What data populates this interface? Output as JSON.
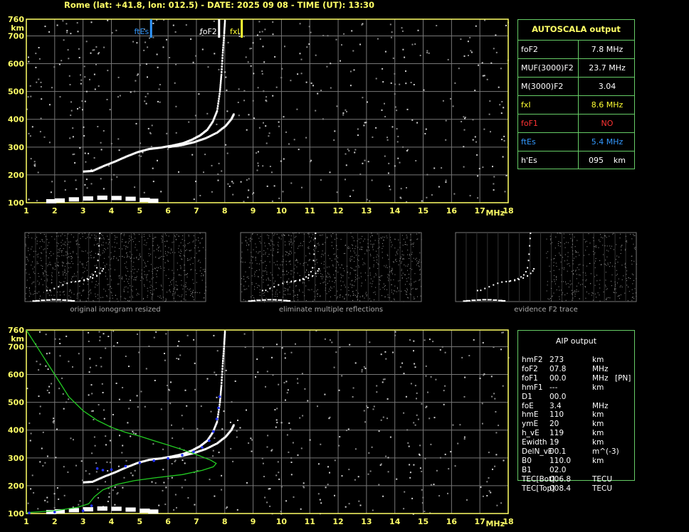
{
  "header": {
    "title": "Rome (lat: +41.8, lon: 012.5) - DATE: 2025 09 08 - TIME (UT): 13:30"
  },
  "colors": {
    "axis": "#ffff66",
    "grid": "#777777",
    "panel_border": "#66cc66",
    "fte": "#3399ff",
    "fxi": "#ffff33",
    "fof1": "#ff3333",
    "trace": "#ffffff",
    "profile": "#22cc22",
    "fit": "#2233ff"
  },
  "chart_data": [
    {
      "type": "scatter",
      "name": "ionogram",
      "xlabel": "MHz",
      "ylabel": "km",
      "xlim": [
        1,
        18
      ],
      "ylim": [
        100,
        760
      ],
      "xticks": [
        "1",
        "2",
        "3",
        "4",
        "5",
        "6",
        "7",
        "8",
        "9",
        "10",
        "11",
        "12",
        "13",
        "14",
        "15",
        "16",
        "17",
        "18"
      ],
      "yticks": [
        "100",
        "200",
        "300",
        "400",
        "500",
        "600",
        "700",
        "760"
      ],
      "grid": true,
      "markers": [
        {
          "label": "ftEs",
          "x": 5.4,
          "color": "#3399ff"
        },
        {
          "label": "foF2",
          "x": 7.8,
          "color": "#ffffff"
        },
        {
          "label": "fxI",
          "x": 8.6,
          "color": "#ffff33"
        }
      ],
      "o_trace": [
        [
          3.0,
          212
        ],
        [
          3.3,
          214
        ],
        [
          3.7,
          232
        ],
        [
          4.1,
          248
        ],
        [
          4.5,
          266
        ],
        [
          4.9,
          282
        ],
        [
          5.3,
          293
        ],
        [
          5.7,
          298
        ],
        [
          6.1,
          305
        ],
        [
          6.5,
          314
        ],
        [
          6.8,
          326
        ],
        [
          7.1,
          342
        ],
        [
          7.35,
          362
        ],
        [
          7.55,
          392
        ],
        [
          7.7,
          430
        ],
        [
          7.8,
          500
        ],
        [
          7.85,
          560
        ],
        [
          7.9,
          640
        ],
        [
          7.95,
          710
        ],
        [
          7.98,
          760
        ]
      ],
      "x_trace": [
        [
          6.0,
          300
        ],
        [
          6.5,
          308
        ],
        [
          6.9,
          318
        ],
        [
          7.3,
          332
        ],
        [
          7.7,
          352
        ],
        [
          8.0,
          376
        ],
        [
          8.2,
          400
        ],
        [
          8.3,
          420
        ]
      ],
      "e_layer": [
        [
          1.7,
          105
        ],
        [
          2.0,
          108
        ],
        [
          2.5,
          112
        ],
        [
          3.0,
          115
        ],
        [
          3.5,
          118
        ],
        [
          4.0,
          117
        ],
        [
          4.5,
          114
        ],
        [
          5.0,
          110
        ],
        [
          5.3,
          107
        ]
      ]
    },
    {
      "type": "line",
      "name": "profile",
      "xlabel": "MHz",
      "ylabel": "km",
      "xlim": [
        1,
        18
      ],
      "ylim": [
        100,
        760
      ],
      "xticks": [
        "1",
        "2",
        "3",
        "4",
        "5",
        "6",
        "7",
        "8",
        "9",
        "10",
        "11",
        "12",
        "13",
        "14",
        "15",
        "16",
        "17",
        "18"
      ],
      "yticks": [
        "100",
        "200",
        "300",
        "400",
        "500",
        "600",
        "700",
        "760"
      ],
      "grid": true,
      "o_trace": [
        [
          3.0,
          212
        ],
        [
          3.3,
          214
        ],
        [
          3.7,
          232
        ],
        [
          4.1,
          248
        ],
        [
          4.5,
          266
        ],
        [
          4.9,
          282
        ],
        [
          5.3,
          293
        ],
        [
          5.7,
          298
        ],
        [
          6.1,
          305
        ],
        [
          6.5,
          314
        ],
        [
          6.8,
          326
        ],
        [
          7.1,
          342
        ],
        [
          7.35,
          362
        ],
        [
          7.55,
          392
        ],
        [
          7.7,
          430
        ],
        [
          7.8,
          500
        ],
        [
          7.85,
          560
        ],
        [
          7.9,
          640
        ],
        [
          7.95,
          710
        ],
        [
          7.98,
          760
        ]
      ],
      "x_trace": [
        [
          6.0,
          300
        ],
        [
          6.5,
          308
        ],
        [
          6.9,
          318
        ],
        [
          7.3,
          332
        ],
        [
          7.7,
          352
        ],
        [
          8.0,
          376
        ],
        [
          8.2,
          400
        ],
        [
          8.3,
          420
        ]
      ],
      "e_layer": [
        [
          1.7,
          105
        ],
        [
          2.0,
          108
        ],
        [
          2.5,
          112
        ],
        [
          3.0,
          115
        ],
        [
          3.5,
          118
        ],
        [
          4.0,
          117
        ],
        [
          4.5,
          114
        ],
        [
          5.0,
          110
        ],
        [
          5.3,
          107
        ]
      ],
      "fit_trace": [
        [
          1.1,
          102
        ],
        [
          2.0,
          105
        ],
        [
          3.0,
          110
        ],
        [
          3.3,
          128
        ],
        [
          3.5,
          262
        ],
        [
          3.7,
          256
        ],
        [
          4.0,
          258
        ],
        [
          4.5,
          270
        ],
        [
          5.0,
          282
        ],
        [
          5.5,
          290
        ],
        [
          6.0,
          298
        ],
        [
          6.5,
          310
        ],
        [
          6.9,
          322
        ],
        [
          7.2,
          338
        ],
        [
          7.45,
          362
        ],
        [
          7.6,
          395
        ],
        [
          7.72,
          440
        ],
        [
          7.78,
          480
        ],
        [
          7.82,
          520
        ]
      ],
      "profile_line": [
        [
          1.0,
          760
        ],
        [
          1.5,
          680
        ],
        [
          2.0,
          600
        ],
        [
          2.5,
          520
        ],
        [
          3.0,
          470
        ],
        [
          3.5,
          435
        ],
        [
          4.0,
          410
        ],
        [
          4.5,
          392
        ],
        [
          5.0,
          378
        ],
        [
          5.5,
          362
        ],
        [
          6.0,
          346
        ],
        [
          6.5,
          330
        ],
        [
          7.0,
          312
        ],
        [
          7.5,
          292
        ],
        [
          7.7,
          280
        ],
        [
          7.6,
          268
        ],
        [
          7.2,
          255
        ],
        [
          6.5,
          240
        ],
        [
          5.5,
          228
        ],
        [
          4.8,
          218
        ],
        [
          4.2,
          205
        ],
        [
          3.7,
          185
        ],
        [
          3.4,
          160
        ],
        [
          3.2,
          135
        ],
        [
          2.8,
          122
        ],
        [
          2.0,
          110
        ],
        [
          1.3,
          105
        ],
        [
          1.0,
          103
        ]
      ]
    }
  ],
  "thumbnails": [
    {
      "caption": "original ionogram resized"
    },
    {
      "caption": "eliminate multiple reflections"
    },
    {
      "caption": "evidence F2 trace"
    }
  ],
  "autoscala": {
    "title": "AUTOSCALA output",
    "rows": [
      {
        "label": "foF2",
        "value": "7.8 MHz",
        "color": "#ffffff"
      },
      {
        "label": "MUF(3000)F2",
        "value": "23.7 MHz",
        "color": "#ffffff"
      },
      {
        "label": "M(3000)F2",
        "value": "3.04",
        "color": "#ffffff"
      },
      {
        "label": "fxI",
        "value": "8.6 MHz",
        "color": "#ffff33"
      },
      {
        "label": "foF1",
        "value": "NO",
        "color": "#ff3333"
      },
      {
        "label": "ftEs",
        "value": "5.4 MHz",
        "color": "#3399ff"
      },
      {
        "label": "h'Es",
        "value": "095    km",
        "color": "#ffffff"
      }
    ]
  },
  "aip": {
    "title": "AIP output",
    "rows": [
      {
        "label": "hmF2",
        "value": "273",
        "unit": "km",
        "extra": ""
      },
      {
        "label": "foF2",
        "value": "07.8",
        "unit": "MHz",
        "extra": ""
      },
      {
        "label": "foF1",
        "value": "00.0",
        "unit": "MHz",
        "extra": "[PN]"
      },
      {
        "label": "hmF1",
        "value": "---",
        "unit": "km",
        "extra": ""
      },
      {
        "label": "D1",
        "value": "00.0",
        "unit": "",
        "extra": ""
      },
      {
        "label": "foE",
        "value": "3.4",
        "unit": "MHz",
        "extra": ""
      },
      {
        "label": "hmE",
        "value": "110",
        "unit": "km",
        "extra": ""
      },
      {
        "label": "ymE",
        "value": "20",
        "unit": "km",
        "extra": ""
      },
      {
        "label": "h_vE",
        "value": "119",
        "unit": "km",
        "extra": ""
      },
      {
        "label": "Ewidth",
        "value": "19",
        "unit": "km",
        "extra": ""
      },
      {
        "label": "DelN_vE",
        "value": "00.1",
        "unit": "m^(-3)",
        "extra": ""
      },
      {
        "label": "B0",
        "value": "110.0",
        "unit": "km",
        "extra": ""
      },
      {
        "label": "B1",
        "value": "02.0",
        "unit": "",
        "extra": ""
      },
      {
        "label": "TEC[Bot]",
        "value": "006.8",
        "unit": "TECU",
        "extra": ""
      },
      {
        "label": "TEC[Top]",
        "value": "008.4",
        "unit": "TECU",
        "extra": ""
      }
    ]
  }
}
